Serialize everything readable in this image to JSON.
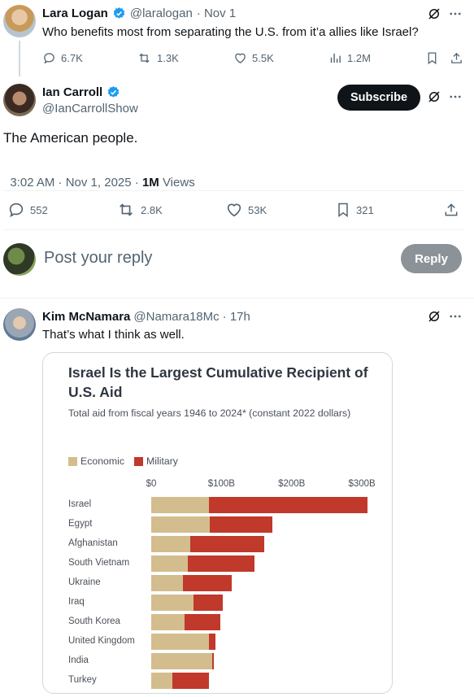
{
  "quoted_post": {
    "name": "Lara Logan",
    "handle": "@laralogan",
    "date": "· Nov 1",
    "text": "Who benefits most from separating the U.S. from it’a allies like Israel?",
    "stats": {
      "replies": "6.7K",
      "reposts": "1.3K",
      "likes": "5.5K",
      "views": "1.2M"
    }
  },
  "main_post": {
    "name": "Ian Carroll",
    "handle": "@IanCarrollShow",
    "subscribe_label": "Subscribe",
    "text": "The American people.",
    "timestamp": "3:02 AM · Nov 1, 2025 · ",
    "views_count": "1M",
    "views_label": " Views",
    "stats": {
      "replies": "552",
      "reposts": "2.8K",
      "likes": "53K",
      "bookmarks": "321"
    }
  },
  "reply_composer": {
    "placeholder": "Post your reply",
    "reply_label": "Reply"
  },
  "reply_post": {
    "name": "Kim McNamara",
    "handle": "@Namara18Mc",
    "date": "· 17h",
    "text": "That’s what I think as well."
  },
  "colors": {
    "economic": "#d3bd8e",
    "military": "#c0392b",
    "accent_blue": "#1d9bf0"
  },
  "chart_data": {
    "type": "bar",
    "stacked": true,
    "orientation": "horizontal",
    "title": "Israel Is the Largest Cumulative Recipient of U.S. Aid",
    "subtitle": "Total aid from fiscal years 1946 to 2024* (constant 2022 dollars)",
    "unit": "billions of constant 2022 US dollars",
    "categories": [
      "Israel",
      "Egypt",
      "Afghanistan",
      "South Vietnam",
      "Ukraine",
      "Iraq",
      "South Korea",
      "United Kingdom",
      "India",
      "Turkey"
    ],
    "series": [
      {
        "name": "Economic",
        "values": [
          82,
          83,
          56,
          52,
          45,
          60,
          47,
          82,
          87,
          30
        ]
      },
      {
        "name": "Military",
        "values": [
          226,
          90,
          105,
          95,
          70,
          42,
          51,
          10,
          2,
          52
        ]
      }
    ],
    "xlim": [
      0,
      308
    ],
    "ticks": [
      {
        "value": 0,
        "label": "$0"
      },
      {
        "value": 100,
        "label": "$100B"
      },
      {
        "value": 200,
        "label": "$200B"
      },
      {
        "value": 300,
        "label": "$300B"
      }
    ],
    "legend_position": "top-left"
  }
}
